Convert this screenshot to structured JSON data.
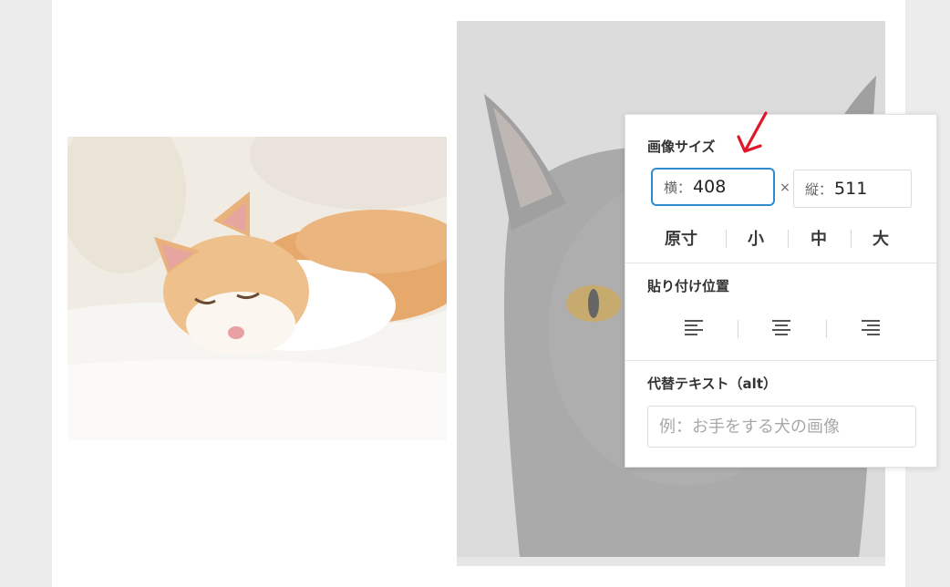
{
  "image_size": {
    "title": "画像サイズ",
    "width_label": "横：",
    "width_value": "408",
    "separator": "×",
    "height_label": "縦：",
    "height_value": "511",
    "presets": [
      "原寸",
      "小",
      "中",
      "大"
    ]
  },
  "paste_position": {
    "title": "貼り付け位置",
    "options": [
      "align-left-icon",
      "align-center-icon",
      "align-right-icon"
    ]
  },
  "alt_text": {
    "title": "代替テキスト（alt）",
    "placeholder": "例：お手をする犬の画像"
  },
  "colors": {
    "accent_border": "#2e8bcf",
    "annotation_arrow": "#e0162b"
  }
}
